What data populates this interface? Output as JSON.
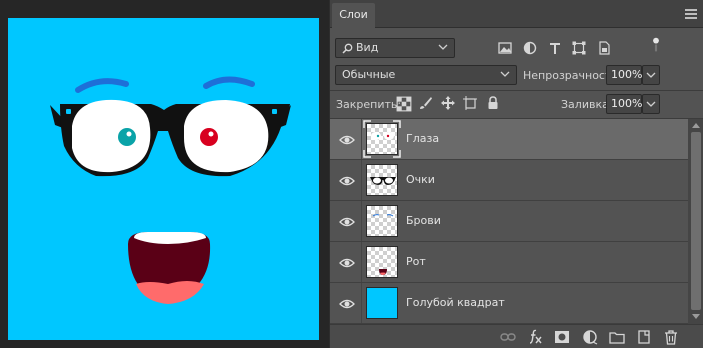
{
  "panel": {
    "tab_title": "Слои",
    "filter": {
      "label": "Вид"
    },
    "blend_mode": "Обычные",
    "opacity": {
      "label": "Непрозрачность:",
      "value": "100%"
    },
    "lock": {
      "label": "Закрепить:"
    },
    "fill": {
      "label": "Заливка:",
      "value": "100%"
    }
  },
  "layers": [
    {
      "name": "Глаза",
      "visible": true,
      "selected": true,
      "thumb": "eyes"
    },
    {
      "name": "Очки",
      "visible": true,
      "selected": false,
      "thumb": "glasses"
    },
    {
      "name": "Брови",
      "visible": true,
      "selected": false,
      "thumb": "brows"
    },
    {
      "name": "Рот",
      "visible": true,
      "selected": false,
      "thumb": "mouth"
    },
    {
      "name": "Голубой квадрат",
      "visible": true,
      "selected": false,
      "thumb": "solid"
    }
  ],
  "colors": {
    "canvas_background": "#00c7ff",
    "panel_background": "#535353",
    "selected_row": "#6a6a6a",
    "brow": "#1e6fd8",
    "glasses_frame": "#111111",
    "pupil_left": "#0aa3a8",
    "pupil_right": "#d8001f",
    "mouth": "#5a0016",
    "tongue": "#ff6b6b"
  },
  "icons": {
    "filter": [
      "filter-image-icon",
      "filter-adjustment-icon",
      "filter-type-icon",
      "filter-shape-icon",
      "filter-smart-object-icon",
      "filter-toggle-icon"
    ],
    "lock": [
      "lock-transparent-pixels-icon",
      "lock-image-pixels-icon",
      "lock-position-icon",
      "lock-artboard-icon",
      "lock-all-icon"
    ],
    "bottom": [
      "link-layers-icon",
      "fx-icon",
      "add-mask-icon",
      "adjustment-layer-icon",
      "new-group-icon",
      "new-layer-icon",
      "delete-layer-icon"
    ]
  }
}
